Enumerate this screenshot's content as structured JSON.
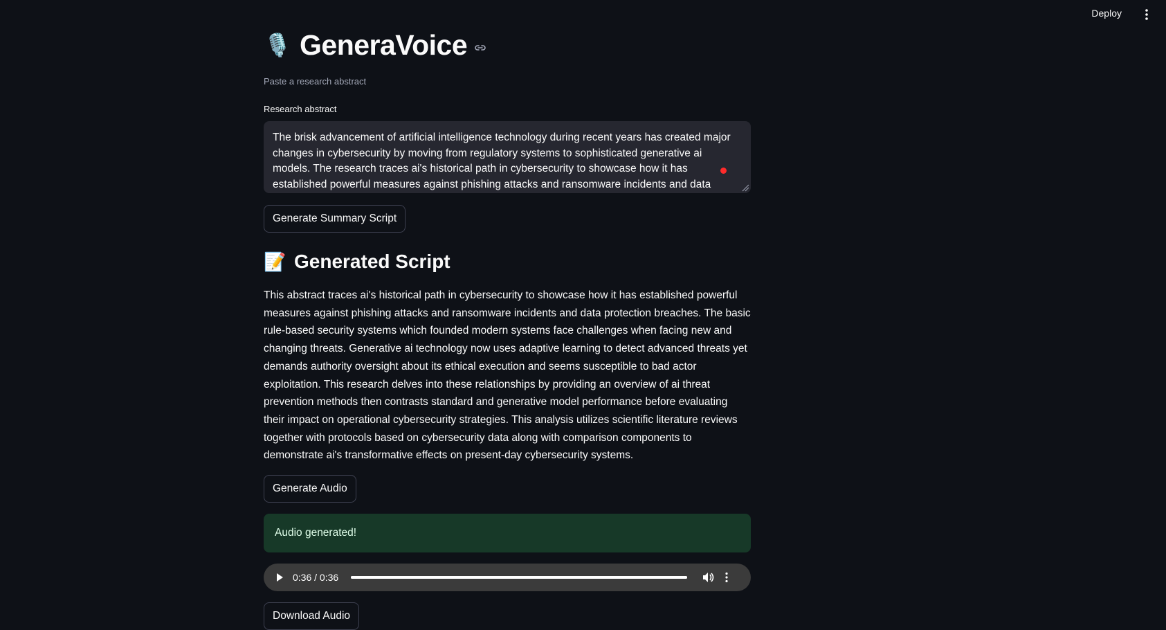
{
  "header": {
    "deploy_label": "Deploy",
    "menu_icon": "kebab-menu-icon"
  },
  "app": {
    "title": "GeneraVoice",
    "title_icon": "🎙️",
    "subtitle": "Paste a research abstract"
  },
  "abstract_input": {
    "label": "Research abstract",
    "value": "The brisk advancement of artificial intelligence technology during recent years has created major changes in cybersecurity by moving from regulatory systems to sophisticated generative ai models. The research traces ai's historical path in cybersecurity to showcase how it has established powerful measures against phishing attacks and ransomware incidents and data protection breaches. The"
  },
  "buttons": {
    "generate_summary": "Generate Summary Script",
    "generate_audio": "Generate Audio",
    "download_audio": "Download Audio"
  },
  "script_section": {
    "icon": "📝",
    "title": "Generated Script",
    "text": "This abstract traces ai's historical path in cybersecurity to showcase how it has established powerful measures against phishing attacks and ransomware incidents and data protection breaches. The basic rule-based security systems which founded modern systems face challenges when facing new and changing threats. Generative ai technology now uses adaptive learning to detect advanced threats yet demands authority oversight about its ethical execution and seems susceptible to bad actor exploitation. This research delves into these relationships by providing an overview of ai threat prevention methods then contrasts standard and generative model performance before evaluating their impact on operational cybersecurity strategies. This analysis utilizes scientific literature reviews together with protocols based on cybersecurity data along with comparison components to demonstrate ai's transformative effects on present-day cybersecurity systems."
  },
  "status": {
    "message": "Audio generated!",
    "color": "#173928"
  },
  "audio_player": {
    "time": "0:36 / 0:36",
    "progress_fraction": 1.0
  },
  "colors": {
    "background": "#0e1117",
    "input_bg": "#262730",
    "success_bg": "#173928"
  }
}
